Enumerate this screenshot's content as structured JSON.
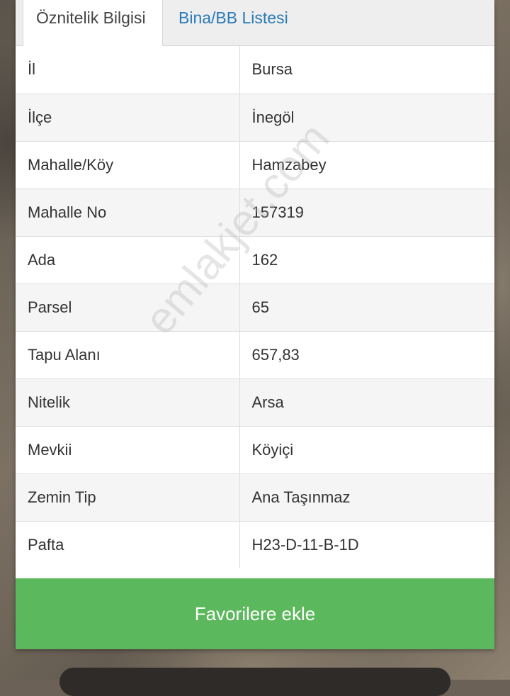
{
  "tabs": {
    "active_label": "Öznitelik Bilgisi",
    "inactive_label": "Bina/BB Listesi"
  },
  "attributes": [
    {
      "key": "İl",
      "value": "Bursa"
    },
    {
      "key": "İlçe",
      "value": "İnegöl"
    },
    {
      "key": "Mahalle/Köy",
      "value": "Hamzabey"
    },
    {
      "key": "Mahalle No",
      "value": "157319"
    },
    {
      "key": "Ada",
      "value": "162"
    },
    {
      "key": "Parsel",
      "value": "65"
    },
    {
      "key": "Tapu Alanı",
      "value": "657,83"
    },
    {
      "key": "Nitelik",
      "value": "Arsa"
    },
    {
      "key": "Mevkii",
      "value": "Köyiçi"
    },
    {
      "key": "Zemin Tip",
      "value": "Ana Taşınmaz"
    },
    {
      "key": "Pafta",
      "value": "H23-D-11-B-1D"
    }
  ],
  "favorite_button_label": "Favorilere ekle",
  "watermark": "emlakjet.com",
  "colors": {
    "tab_link": "#2a7ab8",
    "button": "#5cb85c"
  }
}
